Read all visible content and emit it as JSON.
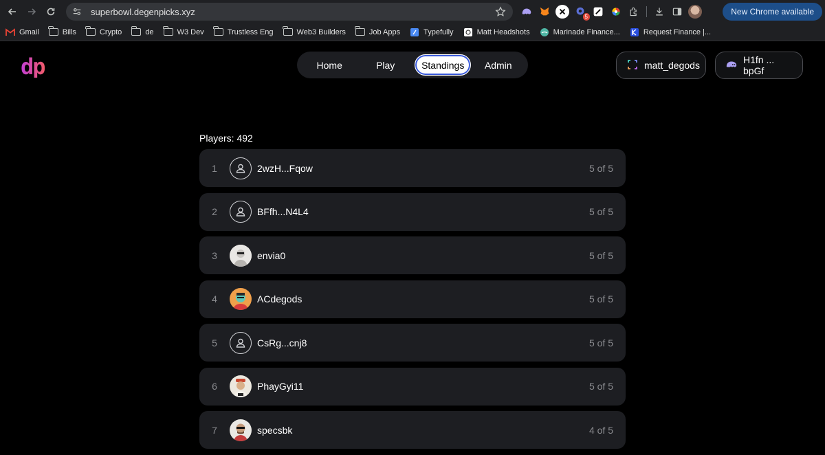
{
  "browser": {
    "url": "superbowl.degenpicks.xyz",
    "update_label": "New Chrome available",
    "extension_badge": "5",
    "bookmarks": [
      {
        "label": "Gmail",
        "icon": "gmail-icon"
      },
      {
        "label": "Bills",
        "icon": "folder-icon"
      },
      {
        "label": "Crypto",
        "icon": "folder-icon"
      },
      {
        "label": "de",
        "icon": "folder-icon"
      },
      {
        "label": "W3 Dev",
        "icon": "folder-icon"
      },
      {
        "label": "Trustless Eng",
        "icon": "folder-icon"
      },
      {
        "label": "Web3 Builders",
        "icon": "folder-icon"
      },
      {
        "label": "Job Apps",
        "icon": "folder-icon"
      },
      {
        "label": "Typefully",
        "icon": "typefully-icon"
      },
      {
        "label": "Matt Headshots",
        "icon": "site-icon"
      },
      {
        "label": "Marinade Finance...",
        "icon": "marinade-icon"
      },
      {
        "label": "Request Finance |...",
        "icon": "request-finance-icon"
      }
    ]
  },
  "app": {
    "logo": "dp",
    "nav": {
      "home": "Home",
      "play": "Play",
      "standings": "Standings",
      "admin": "Admin"
    },
    "user_button": "matt_degods",
    "wallet_button": "H1fn ... bpGf",
    "players_label": "Players: 492",
    "standings": [
      {
        "rank": "1",
        "name": "2wzH...Fqow",
        "score": "5 of 5",
        "avatar": "generic"
      },
      {
        "rank": "2",
        "name": "BFfh...N4L4",
        "score": "5 of 5",
        "avatar": "generic"
      },
      {
        "rank": "3",
        "name": "envia0",
        "score": "5 of 5",
        "avatar": "photo"
      },
      {
        "rank": "4",
        "name": "ACdegods",
        "score": "5 of 5",
        "avatar": "photo"
      },
      {
        "rank": "5",
        "name": "CsRg...cnj8",
        "score": "5 of 5",
        "avatar": "generic"
      },
      {
        "rank": "6",
        "name": "PhayGyi11",
        "score": "5 of 5",
        "avatar": "photo"
      },
      {
        "rank": "7",
        "name": "specsbk",
        "score": "4 of 5",
        "avatar": "photo"
      }
    ]
  },
  "colors": {
    "background": "#000000",
    "card": "#1d1e22",
    "muted_text": "#8b8c90",
    "accent": "#3b5bdb",
    "logo_gradient_start": "#c13ed6",
    "logo_gradient_end": "#f15a6a"
  }
}
